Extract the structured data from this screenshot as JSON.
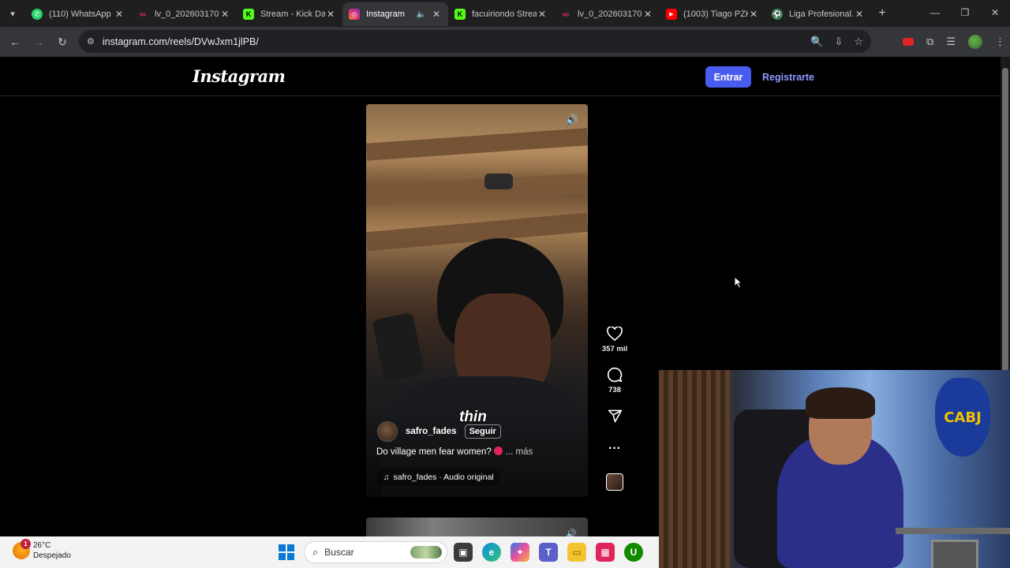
{
  "browser": {
    "tabs": [
      {
        "title": "(110) WhatsApp",
        "icon": "whatsapp-icon",
        "color": "#25d366",
        "active": false
      },
      {
        "title": "lv_0_202603170...",
        "icon": "capcut-icon",
        "color": "#e0245e",
        "active": false
      },
      {
        "title": "Stream - Kick Da...",
        "icon": "kick-icon",
        "color": "#53fc18",
        "active": false
      },
      {
        "title": "Instagram",
        "icon": "instagram-icon",
        "color": "#d62976",
        "active": true
      },
      {
        "title": "facuiriondo Strea...",
        "icon": "kick-icon",
        "color": "#53fc18",
        "active": false
      },
      {
        "title": "lv_0_202603170...",
        "icon": "capcut-icon",
        "color": "#e0245e",
        "active": false
      },
      {
        "title": "(1003) Tiago PZK...",
        "icon": "youtube-icon",
        "color": "#ff0000",
        "active": false
      },
      {
        "title": "Liga Profesional...",
        "icon": "liga-icon",
        "color": "#2e8b57",
        "active": false
      }
    ],
    "url": "instagram.com/reels/DVwJxm1jlPB/"
  },
  "instagram": {
    "logo": "Instagram",
    "login_label": "Entrar",
    "signup_label": "Registrarte",
    "reel": {
      "overlay_text": "thin",
      "author": "safro_fades",
      "follow_label": "Seguir",
      "caption": "Do village men fear women?",
      "more_label": "... más",
      "audio": "safro_fades · Audio original",
      "likes": "357 mil",
      "comments": "738"
    }
  },
  "taskbar": {
    "temperature": "26°C",
    "weather": "Despejado",
    "notification_count": "1",
    "search_placeholder": "Buscar"
  },
  "webcam": {
    "badge_text": "CABJ"
  },
  "colors": {
    "accent": "#4a5cf0",
    "link": "#8c9bff",
    "tab_active": "#35363a"
  }
}
